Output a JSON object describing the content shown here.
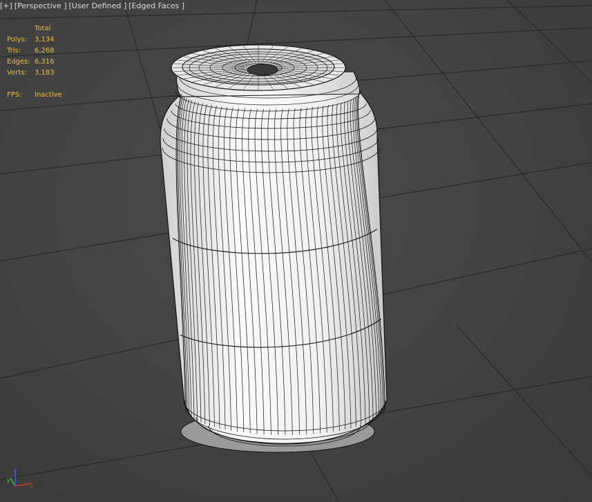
{
  "viewport": {
    "labels": {
      "menu": "[+]",
      "view": "[Perspective ]",
      "shading": "[User Defined ]",
      "display": "[Edged Faces ]"
    },
    "stats": {
      "header": "Total",
      "rows": [
        {
          "label": "Polys:",
          "value": "3,134"
        },
        {
          "label": "Tris:",
          "value": "6,268"
        },
        {
          "label": "Edges:",
          "value": "6,316"
        },
        {
          "label": "Verts:",
          "value": "3,183"
        }
      ],
      "fps_label": "FPS:",
      "fps_value": "Inactive"
    },
    "gizmo": {
      "x": "x",
      "y": "y",
      "z": "z"
    },
    "colors": {
      "background": "#444444",
      "grid": "#2a2a2a",
      "stats_text": "#ecc23e",
      "label_text": "#dcdcdc",
      "mesh_fill": "#f0f0f0",
      "wire": "#111111",
      "axis_x": "#d03a2a",
      "axis_y": "#3cc23c",
      "axis_z": "#3a5ad8"
    },
    "object": "can"
  }
}
